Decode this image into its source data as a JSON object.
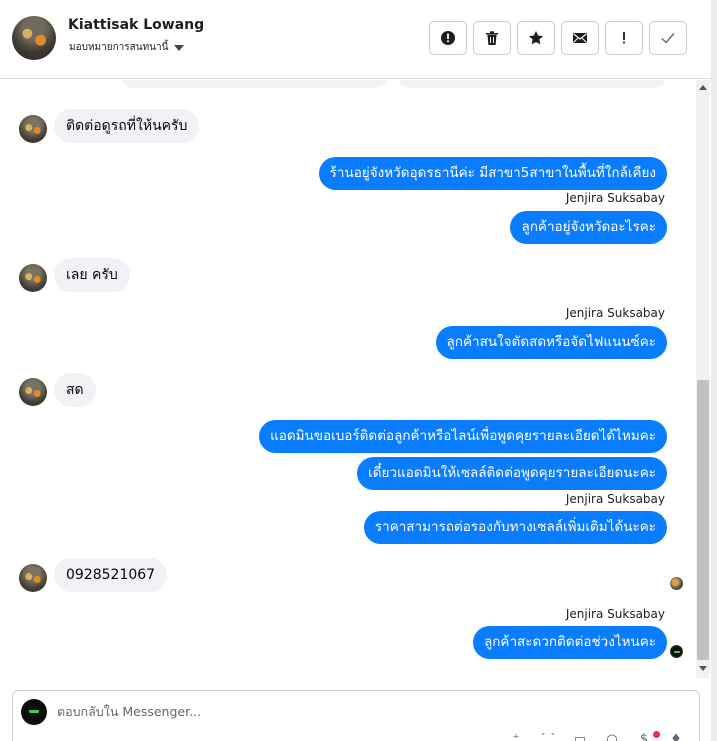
{
  "header": {
    "name": "Kiattisak Lowang",
    "subtitle": "มอบหมายการสนทนานี้",
    "actions": [
      {
        "name": "spam-action",
        "icon": "alert-circle-icon"
      },
      {
        "name": "delete-action",
        "icon": "trash-icon"
      },
      {
        "name": "star-action",
        "icon": "star-icon"
      },
      {
        "name": "mark-unread-action",
        "icon": "envelope-icon"
      },
      {
        "name": "follow-up-action",
        "icon": "exclamation-icon"
      },
      {
        "name": "done-action",
        "icon": "check-icon"
      }
    ]
  },
  "messages": {
    "m1": "ติดต่อดูรถที่ให้นครับ",
    "m2": "ร้านอยู่จังหวัดอุดรธานีค่ะ มีสาขา5สาขาในพื้นที่ใกล้เคียง",
    "m3_sender": "Jenjira Suksabay",
    "m3": "ลูกค้าอยู่จังหวัดอะไรคะ",
    "m4": "เลย ครับ",
    "m5_sender": "Jenjira Suksabay",
    "m5": "ลูกค้าสนใจตัดสดหรือจัดไฟแนนซ์คะ",
    "m6": "สด",
    "m7": "แอดมินขอเบอร์ติดต่อลูกค้าหรือไลน์เพื่อพูดคุยรายละเอียดได้ไหมคะ",
    "m8": "เดี๋ยวแอดมินให้เซลล์ติดต่อพูดคุยรายละเอียดนะคะ",
    "m9_sender": "Jenjira Suksabay",
    "m9": "ราคาสามารถต่อรองกับทางเซลล์เพิ่มเติมได้นะคะ",
    "m10": "0928521067",
    "m11_sender": "Jenjira Suksabay",
    "m11": "ลูกค้าสะดวกติดต่อช่วงไหนคะ"
  },
  "composer": {
    "placeholder": "ตอบกลับใน Messenger..."
  },
  "colors": {
    "outgoing_bubble": "#0a7cff",
    "incoming_bubble": "#f0f2f5",
    "notification": "#f02849"
  }
}
